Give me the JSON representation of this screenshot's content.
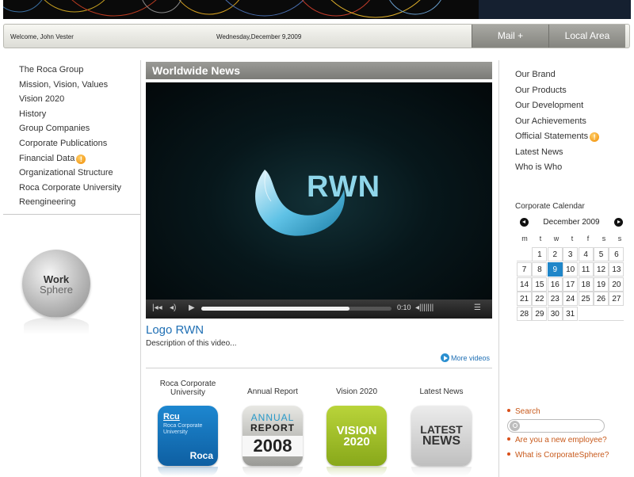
{
  "topbar": {
    "welcome": "Welcome, John Vester",
    "date": "Wednesday,December 9,2009",
    "mail": "Mail +",
    "local": "Local Area"
  },
  "leftnav": [
    {
      "label": "The Roca Group"
    },
    {
      "label": "Mission, Vision, Values"
    },
    {
      "label": "Vision 2020"
    },
    {
      "label": "History"
    },
    {
      "label": "Group Companies"
    },
    {
      "label": "Corporate Publications"
    },
    {
      "label": "Financial Data",
      "alert": true
    },
    {
      "label": "Organizational Structure"
    },
    {
      "label": "Roca Corporate University"
    },
    {
      "label": "Reengineering"
    }
  ],
  "workbadge": {
    "line1": "Work",
    "line2": "Sphere"
  },
  "news": {
    "heading": "Worldwide News",
    "logo_text": "RWN",
    "time": "0:10",
    "progress": 0.78,
    "video_title": "Logo RWN",
    "video_desc": "Description of this video...",
    "more_videos": "More videos"
  },
  "tiles": [
    {
      "label": "Roca Corporate University",
      "text_top": "Rcu",
      "text_sub": "Roca Corporate University",
      "text_bottom": "Roca"
    },
    {
      "label": "Annual Report",
      "text_top": "ANNUAL",
      "text_mid": "REPORT",
      "text_bottom": "2008"
    },
    {
      "label": "Vision 2020",
      "text_top": "VISION",
      "text_bottom": "2020"
    },
    {
      "label": "Latest News",
      "text_top": "LATEST",
      "text_bottom": "NEWS"
    }
  ],
  "rightnav": [
    {
      "label": "Our Brand"
    },
    {
      "label": "Our Products"
    },
    {
      "label": "Our Development"
    },
    {
      "label": "Our Achievements"
    },
    {
      "label": "Official Statements",
      "alert": true
    },
    {
      "label": "Latest News"
    },
    {
      "label": "Who is Who"
    }
  ],
  "calendar": {
    "title": "Corporate Calendar",
    "month": "December 2009",
    "dows": [
      "m",
      "t",
      "w",
      "t",
      "f",
      "s",
      "s"
    ],
    "weeks": [
      [
        "",
        "1",
        "2",
        "3",
        "4",
        "5",
        "6"
      ],
      [
        "7",
        "8",
        "9",
        "10",
        "11",
        "12",
        "13"
      ],
      [
        "14",
        "15",
        "16",
        "17",
        "18",
        "19",
        "20"
      ],
      [
        "21",
        "22",
        "23",
        "24",
        "25",
        "26",
        "27"
      ],
      [
        "28",
        "29",
        "30",
        "31",
        "",
        "",
        ""
      ]
    ],
    "today": "9"
  },
  "bottom_links": {
    "search_label": "Search",
    "new_employee": "Are you a new employee?",
    "what_is": "What is CorporateSphere?"
  },
  "colors": {
    "accent": "#1f86c9",
    "link": "#1f6fb4",
    "orange": "#c85a1c"
  }
}
